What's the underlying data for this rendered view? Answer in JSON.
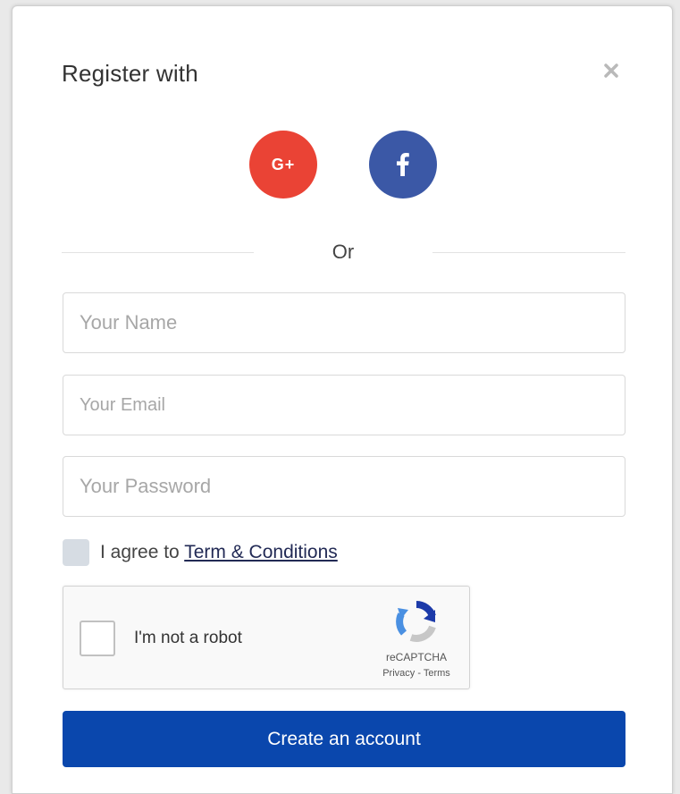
{
  "modal": {
    "title": "Register with",
    "close_icon": "close-icon"
  },
  "social": {
    "google_label": "G+",
    "google_color": "#ea4335",
    "facebook_label": "f",
    "facebook_color": "#3b58a6"
  },
  "divider": {
    "label": "Or"
  },
  "form": {
    "name_placeholder": "Your Name",
    "email_placeholder": "Your Email",
    "password_placeholder": "Your Password",
    "agree_text": "I agree to",
    "agree_link": "Term & Conditions"
  },
  "recaptcha": {
    "label": "I'm not a robot",
    "brand": "reCAPTCHA",
    "privacy": "Privacy",
    "separator": " - ",
    "terms": "Terms"
  },
  "submit": {
    "label": "Create an account",
    "color": "#0a47ad"
  }
}
